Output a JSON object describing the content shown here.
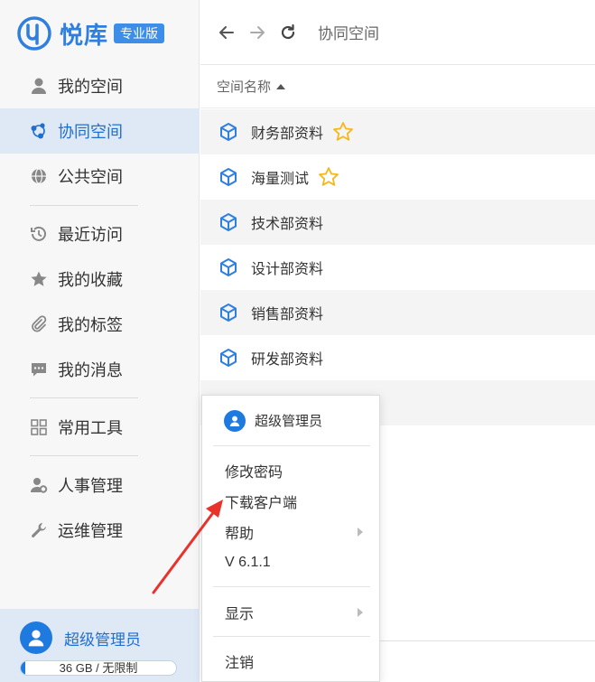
{
  "app": {
    "logo_text": "悦库",
    "edition_badge": "专业版",
    "brand_color": "#2f7fe0"
  },
  "sidebar": {
    "items": [
      {
        "label": "我的空间",
        "icon": "user-icon"
      },
      {
        "label": "协同空间",
        "icon": "share-network-icon",
        "active": true
      },
      {
        "label": "公共空间",
        "icon": "globe-icon"
      },
      {
        "label": "最近访问",
        "icon": "history-icon"
      },
      {
        "label": "我的收藏",
        "icon": "star-icon"
      },
      {
        "label": "我的标签",
        "icon": "paperclip-icon"
      },
      {
        "label": "我的消息",
        "icon": "message-icon"
      },
      {
        "label": "常用工具",
        "icon": "grid-icon"
      },
      {
        "label": "人事管理",
        "icon": "user-settings-icon"
      },
      {
        "label": "运维管理",
        "icon": "wrench-icon"
      }
    ]
  },
  "user": {
    "name": "超级管理员",
    "storage_text": "36 GB / 无限制",
    "storage_fraction": 0.03
  },
  "toolbar": {
    "breadcrumb": "协同空间"
  },
  "list": {
    "column_header": "空间名称",
    "rows": [
      {
        "name": "财务部资料",
        "starred": true
      },
      {
        "name": "海量测试",
        "starred": true
      },
      {
        "name": "技术部资料",
        "starred": false
      },
      {
        "name": "设计部资料",
        "starred": false
      },
      {
        "name": "销售部资料",
        "starred": false
      },
      {
        "name": "研发部资料",
        "starred": false
      }
    ]
  },
  "menu": {
    "user_name": "超级管理员",
    "items": [
      {
        "label": "修改密码"
      },
      {
        "label": "下载客户端"
      },
      {
        "label": "帮助",
        "has_submenu": true
      },
      {
        "label": "V 6.1.1"
      },
      {
        "label": "显示",
        "has_submenu": true
      },
      {
        "label": "注销"
      }
    ]
  },
  "colors": {
    "accent": "#1f7ae0",
    "active_bg": "#dfe9f6",
    "star": "#f5b81c",
    "annotation_arrow": "#e8322b"
  }
}
